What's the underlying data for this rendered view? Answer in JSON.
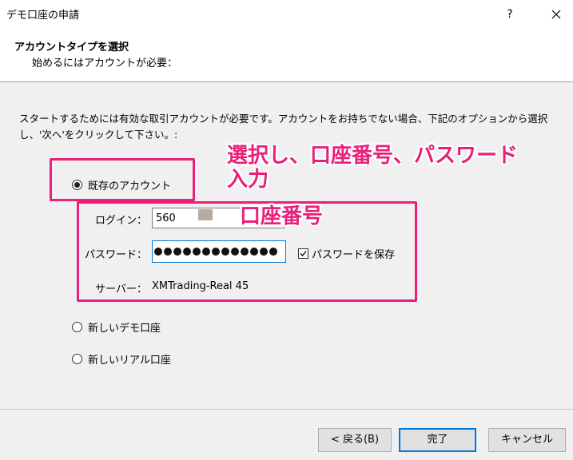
{
  "window": {
    "title": "デモ口座の申請",
    "help_label": "?"
  },
  "header": {
    "title": "アカウントタイプを選択",
    "subtitle": "始めるにはアカウントが必要："
  },
  "description": "スタートするためには有効な取引アカウントが必要です。アカウントをお持ちでない場合、下記のオプションから選択し、'次へ'をクリックして下さい。:",
  "options": {
    "existing": "既存のアカウント",
    "new_demo": "新しいデモ口座",
    "new_real": "新しいリアル口座"
  },
  "selected_option": "existing",
  "form": {
    "login_label": "ログイン：",
    "login_value": "560",
    "password_label": "パスワード：",
    "password_mask_count": 13,
    "save_password_label": "パスワードを保存",
    "save_password_checked": true,
    "server_label": "サーバー：",
    "server_value": "XMTrading-Real 45"
  },
  "annotations": {
    "select_text_line1": "選択し、口座番号、パスワード",
    "select_text_line2": "入力",
    "account_number_text": "口座番号",
    "color": "#e8207a"
  },
  "buttons": {
    "back": "< 戻る(B)",
    "finish": "完了",
    "cancel": "キャンセル"
  }
}
